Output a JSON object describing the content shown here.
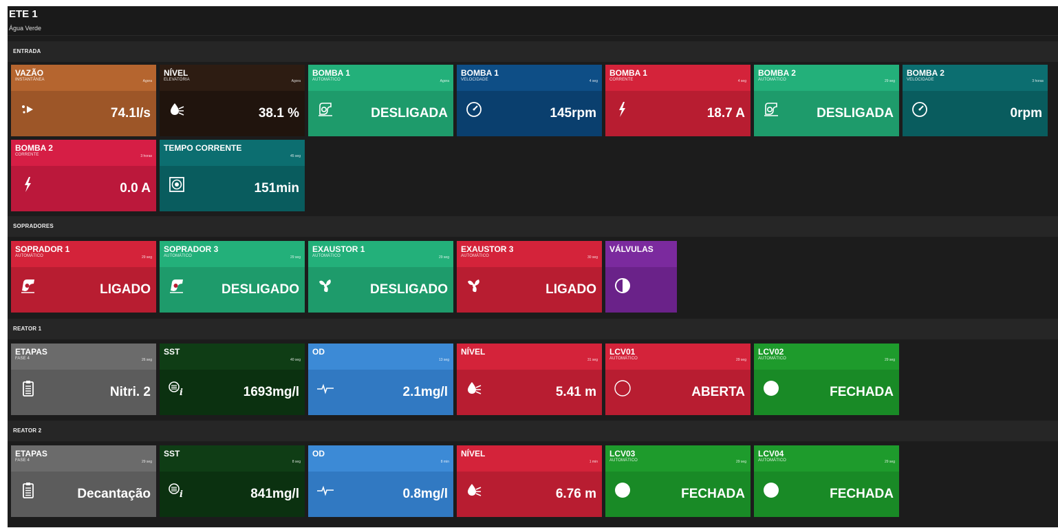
{
  "header": {
    "title": "ETE 1",
    "subtitle": "Água Verde"
  },
  "sections": {
    "entrada": "ENTRADA",
    "sopradores": "SOPRADORES",
    "reator1": "REATOR 1",
    "reator2": "REATOR 2"
  },
  "tiles": {
    "vazao": {
      "name": "VAZÃO",
      "sub": "INSTANTÂNEA",
      "time": "Agora",
      "value": "74.1l/s",
      "color": "#b5652f",
      "color_bottom": "#9d5628",
      "icon": "flow-arrow-icon"
    },
    "nivel_elev": {
      "name": "NÍVEL",
      "sub": "ELEVATÓRIA",
      "time": "Agora",
      "value": "38.1 %",
      "color": "#2d1c12",
      "color_bottom": "#20140d",
      "icon": "water-level-icon"
    },
    "bomba1_auto": {
      "name": "BOMBA 1",
      "sub": "AUTOMÁTICO",
      "time": "Agora",
      "value": "DESLIGADA",
      "color": "#23b07a",
      "color_bottom": "#1e9b6b",
      "icon": "pump-icon"
    },
    "bomba1_vel": {
      "name": "BOMBA 1",
      "sub": "VELOCIDADE",
      "time": "4 seg",
      "value": "145rpm",
      "color": "#0e4e86",
      "color_bottom": "#0a3f6e",
      "icon": "speedometer-icon"
    },
    "bomba1_corr": {
      "name": "BOMBA 1",
      "sub": "CORRENTE",
      "time": "4 seg",
      "value": "18.7 A",
      "color": "#d4233a",
      "color_bottom": "#b81d31",
      "icon": "lightning-icon"
    },
    "bomba2_auto": {
      "name": "BOMBA 2",
      "sub": "AUTOMÁTICO",
      "time": "29 seg",
      "value": "DESLIGADA",
      "color": "#23b07a",
      "color_bottom": "#1e9b6b",
      "icon": "pump-icon"
    },
    "bomba2_vel": {
      "name": "BOMBA 2",
      "sub": "VELOCIDADE",
      "time": "3 horas",
      "value": "0rpm",
      "color": "#0c6e70",
      "color_bottom": "#095c5e",
      "icon": "speedometer-icon"
    },
    "bomba2_corr": {
      "name": "BOMBA 2",
      "sub": "CORRENTE",
      "time": "3 horas",
      "value": "0.0 A",
      "color": "#d61e45",
      "color_bottom": "#bb183b",
      "icon": "lightning-icon"
    },
    "tempo_corr": {
      "name": "TEMPO CORRENTE",
      "sub": "",
      "time": "45 seg",
      "value": "151min",
      "color": "#0c6e70",
      "color_bottom": "#095c5e",
      "icon": "timer-icon"
    },
    "soprador1": {
      "name": "SOPRADOR 1",
      "sub": "AUTOMÁTICO",
      "time": "29 seg",
      "value": "LIGADO",
      "color": "#d4233a",
      "color_bottom": "#b81d31",
      "icon": "blower-icon"
    },
    "soprador3": {
      "name": "SOPRADOR 3",
      "sub": "AUTOMÁTICO",
      "time": "29 seg",
      "value": "DESLIGADO",
      "color": "#23b07a",
      "color_bottom": "#1e9b6b",
      "icon": "blower-icon"
    },
    "exaustor1": {
      "name": "EXAUSTOR 1",
      "sub": "AUTOMÁTICO",
      "time": "29 seg",
      "value": "DESLIGADO",
      "color": "#23b07a",
      "color_bottom": "#1e9b6b",
      "icon": "fan-icon"
    },
    "exaustor3": {
      "name": "EXAUSTOR 3",
      "sub": "AUTOMÁTICO",
      "time": "30 seg",
      "value": "LIGADO",
      "color": "#d4233a",
      "color_bottom": "#b81d31",
      "icon": "fan-icon"
    },
    "valvulas": {
      "name": "VÁLVULAS",
      "sub": "",
      "time": "",
      "value": "",
      "color": "#7b2a9e",
      "color_bottom": "#6a2289",
      "icon": "half-circle-icon"
    },
    "r1_etapas": {
      "name": "ETAPAS",
      "sub": "FASE 4",
      "time": "26 seg",
      "value": "Nitri. 2",
      "color": "#6b6b6b",
      "color_bottom": "#5c5c5c",
      "icon": "clipboard-icon"
    },
    "r1_sst": {
      "name": "SST",
      "sub": "",
      "time": "40 seg",
      "value": "1693mg/l",
      "color": "#0f3d15",
      "color_bottom": "#0b3110",
      "icon": "solids-icon"
    },
    "r1_od": {
      "name": "OD",
      "sub": "",
      "time": "13 seg",
      "value": "2.1mg/l",
      "color": "#3c8ad6",
      "color_bottom": "#3179c2",
      "icon": "pulse-icon"
    },
    "r1_nivel": {
      "name": "NÍVEL",
      "sub": "",
      "time": "31 seg",
      "value": "5.41 m",
      "color": "#d4233a",
      "color_bottom": "#b81d31",
      "icon": "water-level-icon"
    },
    "lcv01": {
      "name": "LCV01",
      "sub": "AUTOMÁTICO",
      "time": "29 seg",
      "value": "ABERTA",
      "color": "#d4233a",
      "color_bottom": "#b81d31",
      "icon": "valve-open-icon"
    },
    "lcv02": {
      "name": "LCV02",
      "sub": "AUTOMÁTICO",
      "time": "29 seg",
      "value": "FECHADA",
      "color": "#1e9b2c",
      "color_bottom": "#198a26",
      "icon": "valve-closed-icon"
    },
    "r2_etapas": {
      "name": "ETAPAS",
      "sub": "FASE 4",
      "time": "29 seg",
      "value": "Decantação",
      "color": "#6b6b6b",
      "color_bottom": "#5c5c5c",
      "icon": "clipboard-icon"
    },
    "r2_sst": {
      "name": "SST",
      "sub": "",
      "time": "8 seg",
      "value": "841mg/l",
      "color": "#0f3d15",
      "color_bottom": "#0b3110",
      "icon": "solids-icon"
    },
    "r2_od": {
      "name": "OD",
      "sub": "",
      "time": "8 min",
      "value": "0.8mg/l",
      "color": "#3c8ad6",
      "color_bottom": "#3179c2",
      "icon": "pulse-icon"
    },
    "r2_nivel": {
      "name": "NÍVEL",
      "sub": "",
      "time": "1 min",
      "value": "6.76 m",
      "color": "#d4233a",
      "color_bottom": "#b81d31",
      "icon": "water-level-icon"
    },
    "lcv03": {
      "name": "LCV03",
      "sub": "AUTOMÁTICO",
      "time": "29 seg",
      "value": "FECHADA",
      "color": "#1e9b2c",
      "color_bottom": "#198a26",
      "icon": "valve-closed-icon"
    },
    "lcv04": {
      "name": "LCV04",
      "sub": "AUTOMÁTICO",
      "time": "29 seg",
      "value": "FECHADA",
      "color": "#1e9b2c",
      "color_bottom": "#198a26",
      "icon": "valve-closed-icon"
    }
  }
}
